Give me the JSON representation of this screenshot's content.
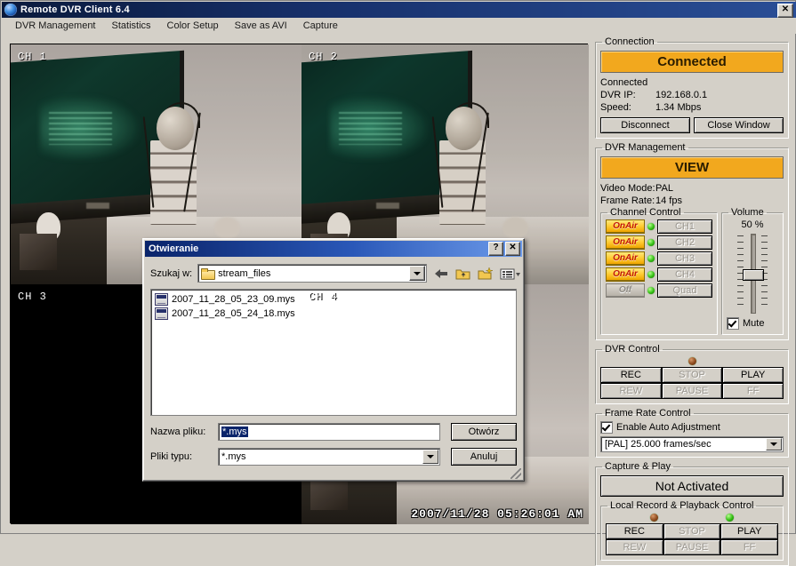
{
  "window": {
    "title": "Remote DVR Client 6.4",
    "app_icon": "globe-icon",
    "close_label": "✕"
  },
  "menu": {
    "items": [
      {
        "label": "DVR Management"
      },
      {
        "label": "Statistics"
      },
      {
        "label": "Color Setup"
      },
      {
        "label": "Save as AVI"
      },
      {
        "label": "Capture"
      }
    ]
  },
  "video": {
    "panes": [
      {
        "label": "CH 1",
        "signal": true
      },
      {
        "label": "CH 2",
        "signal": true
      },
      {
        "label": "CH 3",
        "signal": false
      },
      {
        "label": "CH 4",
        "signal": true
      }
    ],
    "timestamp": "2007/11/28  05:26:01 AM"
  },
  "connection": {
    "legend": "Connection",
    "status_big": "Connected",
    "status_line": "Connected",
    "ip_label": "DVR IP:",
    "ip_value": "192.168.0.1",
    "speed_label": "Speed:",
    "speed_value": "1.34 Mbps",
    "disconnect_label": "Disconnect",
    "close_window_label": "Close Window",
    "accent_color": "#f2a81e"
  },
  "dvr_management": {
    "legend": "DVR Management",
    "mode_big": "VIEW",
    "video_mode_label": "Video Mode:",
    "video_mode_value": "PAL",
    "frame_rate_label": "Frame Rate:",
    "frame_rate_value": "14 fps"
  },
  "channel_control": {
    "legend": "Channel Control",
    "rows": [
      {
        "state": "OnAir",
        "on": true,
        "button": "CH1"
      },
      {
        "state": "OnAir",
        "on": true,
        "button": "CH2"
      },
      {
        "state": "OnAir",
        "on": true,
        "button": "CH3"
      },
      {
        "state": "OnAir",
        "on": true,
        "button": "CH4"
      },
      {
        "state": "Off",
        "on": false,
        "button": "Quad"
      }
    ]
  },
  "volume": {
    "legend": "Volume",
    "percent": "50 %",
    "mute_label": "Mute",
    "mute_checked": true
  },
  "dvr_control": {
    "legend": "DVR Control",
    "buttons": [
      {
        "label": "REC",
        "disabled": false
      },
      {
        "label": "STOP",
        "disabled": true
      },
      {
        "label": "PLAY",
        "disabled": false
      },
      {
        "label": "REW",
        "disabled": true
      },
      {
        "label": "PAUSE",
        "disabled": true
      },
      {
        "label": "FF",
        "disabled": true
      }
    ]
  },
  "frame_rate_control": {
    "legend": "Frame Rate Control",
    "auto_label": "Enable Auto Adjustment",
    "auto_checked": true,
    "selected_rate": "[PAL] 25.000 frames/sec"
  },
  "capture_play": {
    "legend": "Capture & Play",
    "status": "Not Activated"
  },
  "local_control": {
    "legend": "Local Record & Playback Control",
    "buttons": [
      {
        "label": "REC",
        "disabled": false
      },
      {
        "label": "STOP",
        "disabled": true
      },
      {
        "label": "PLAY",
        "disabled": false
      },
      {
        "label": "REW",
        "disabled": true
      },
      {
        "label": "PAUSE",
        "disabled": true
      },
      {
        "label": "FF",
        "disabled": true
      }
    ]
  },
  "dialog": {
    "title": "Otwieranie",
    "help_label": "?",
    "close_label": "✕",
    "look_in_label": "Szukaj w:",
    "look_in_value": "stream_files",
    "toolbar_icons": [
      "back-arrow-icon",
      "up-folder-icon",
      "new-folder-icon",
      "view-menu-icon"
    ],
    "files": [
      {
        "name": "2007_11_28_05_23_09.mys"
      },
      {
        "name": "2007_11_28_05_24_18.mys"
      }
    ],
    "file_name_label": "Nazwa pliku:",
    "file_name_value": "*.mys",
    "file_type_label": "Pliki typu:",
    "file_type_value": "*.mys",
    "open_label": "Otwórz",
    "cancel_label": "Anuluj"
  }
}
